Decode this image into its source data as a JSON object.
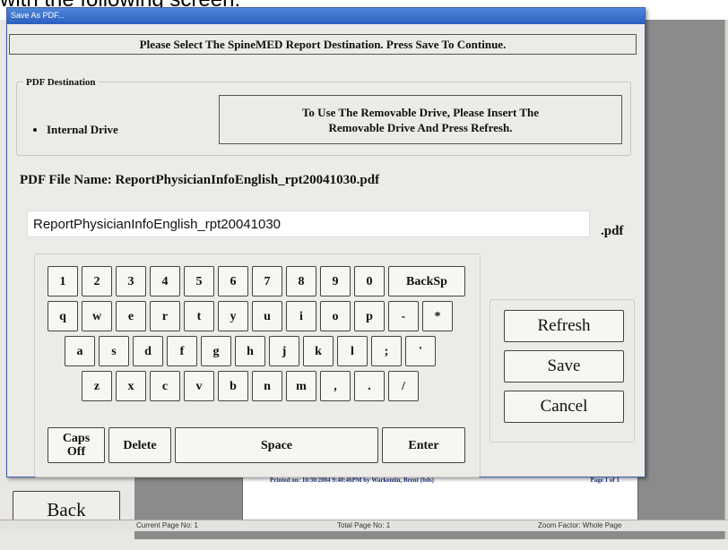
{
  "caption": "with the following screen:",
  "viewer": {
    "back_label": "Back",
    "report_footer": "Printed on: 10/30/2004 9:40:46PM by Warkentin, Brent (bds)",
    "report_page": "Page 1 of 1",
    "status": {
      "current_page": "Current Page No: 1",
      "total_page": "Total Page No: 1",
      "zoom": "Zoom Factor: Whole Page"
    }
  },
  "dialog": {
    "title": "Save As PDF...",
    "header": "Please Select The SpineMED Report Destination. Press Save To Continue.",
    "destination_legend": "PDF Destination",
    "internal_drive_label": "Internal Drive",
    "internal_drive_selected": true,
    "removable_info_line1": "To Use The Removable Drive, Please Insert The",
    "removable_info_line2": "Removable Drive And Press Refresh.",
    "filename_label": "PDF File Name: ReportPhysicianInfoEnglish_rpt20041030.pdf",
    "filename_value": "ReportPhysicianInfoEnglish_rpt20041030",
    "extension": ".pdf",
    "keyboard": {
      "row1": [
        "1",
        "2",
        "3",
        "4",
        "5",
        "6",
        "7",
        "8",
        "9",
        "0",
        "BackSp"
      ],
      "row2": [
        "q",
        "w",
        "e",
        "r",
        "t",
        "y",
        "u",
        "i",
        "o",
        "p",
        "-",
        "*"
      ],
      "row3": [
        "a",
        "s",
        "d",
        "f",
        "g",
        "h",
        "j",
        "k",
        "l",
        ";",
        "'"
      ],
      "row4": [
        "z",
        "x",
        "c",
        "v",
        "b",
        "n",
        "m",
        ",",
        ".",
        "/"
      ],
      "caps_line1": "Caps",
      "caps_line2": "Off",
      "delete": "Delete",
      "space": "Space",
      "enter": "Enter"
    },
    "buttons": {
      "refresh": "Refresh",
      "save": "Save",
      "cancel": "Cancel"
    }
  }
}
